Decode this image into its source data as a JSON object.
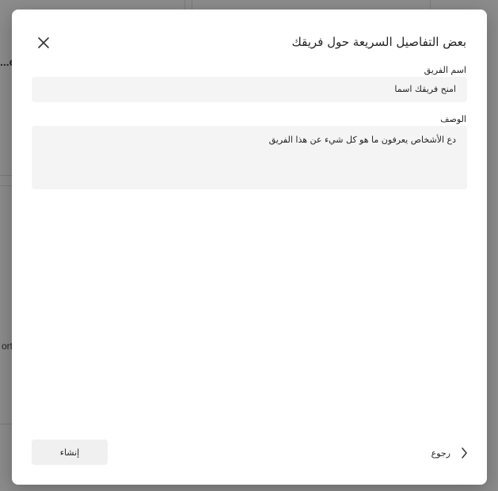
{
  "dialog": {
    "title": "بعض التفاصيل السريعة حول فريقك",
    "name_label": "اسم الفريق",
    "name_placeholder": "امنح فريقك اسما",
    "description_label": "الوصف",
    "description_placeholder": "دع الأشخاص يعرفون ما هو كل شيء عن هذا الفريق",
    "create_label": "إنشاء",
    "back_label": "رجوع"
  },
  "background": {
    "left_edge_text": "...e",
    "left_edge_text_2": "ort"
  },
  "colors": {
    "overlay": "#000000",
    "field_bg": "#f4f4f4",
    "button_bg": "#f0f0f0",
    "text": "#242424"
  },
  "icons": {
    "close": "close-icon",
    "back": "chevron-left-icon"
  }
}
